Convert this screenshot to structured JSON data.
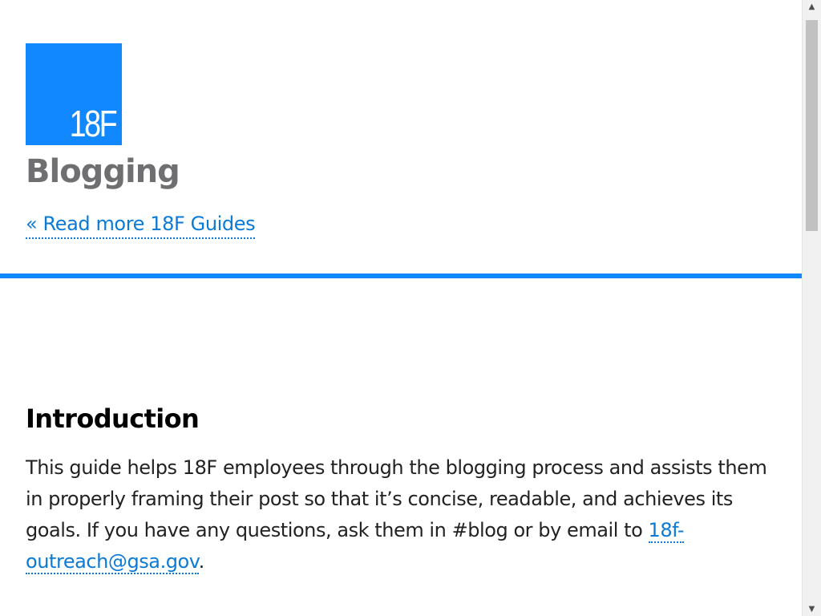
{
  "header": {
    "logo_text": "18F",
    "site_title": "Blogging",
    "back_link": "« Read more 18F Guides"
  },
  "colors": {
    "brand_blue": "#1188ff",
    "link_blue": "#0b7ad6",
    "title_gray": "#6f6f72"
  },
  "content": {
    "heading": "Introduction",
    "paragraph_text_1": "This guide helps 18F employees through the blogging process and assists them in properly framing their post so that it’s concise, readable, and achieves its goals. If you have any questions, ask them in #blog or by email to ",
    "email_link": "18f-outreach@gsa.gov",
    "paragraph_text_2": "."
  },
  "scrollbar": {
    "up_icon": "triangle-up-icon",
    "down_icon": "triangle-down-icon",
    "up_glyph": "▲",
    "down_glyph": "▼"
  }
}
